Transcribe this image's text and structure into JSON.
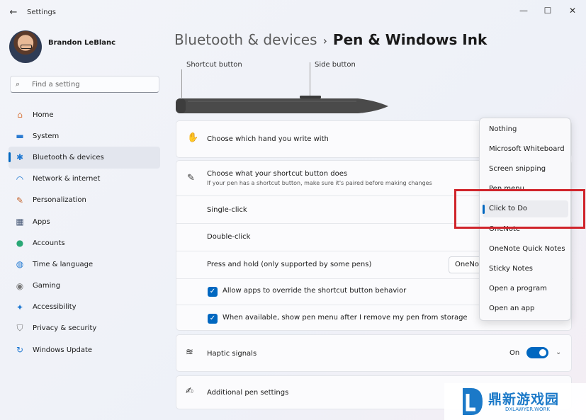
{
  "window": {
    "title": "Settings",
    "back_glyph": "←",
    "min_glyph": "—",
    "max_glyph": "☐",
    "close_glyph": "✕"
  },
  "user": {
    "name": "Brandon LeBlanc"
  },
  "search": {
    "placeholder": "Find a setting",
    "icon": "search-icon"
  },
  "nav": {
    "items": [
      {
        "label": "Home",
        "icon": "home-icon",
        "glyph": "⌂",
        "color": "#d8743a"
      },
      {
        "label": "System",
        "icon": "system-icon",
        "glyph": "▬",
        "color": "#2c7bd1"
      },
      {
        "label": "Bluetooth & devices",
        "icon": "bluetooth-icon",
        "glyph": "✱",
        "color": "#1f78d1",
        "active": true
      },
      {
        "label": "Network & internet",
        "icon": "wifi-icon",
        "glyph": "◠",
        "color": "#1f78d1"
      },
      {
        "label": "Personalization",
        "icon": "brush-icon",
        "glyph": "✎",
        "color": "#c4622a"
      },
      {
        "label": "Apps",
        "icon": "apps-icon",
        "glyph": "▦",
        "color": "#4a5b78"
      },
      {
        "label": "Accounts",
        "icon": "accounts-icon",
        "glyph": "●",
        "color": "#2aa876"
      },
      {
        "label": "Time & language",
        "icon": "globe-icon",
        "glyph": "◍",
        "color": "#1f78d1"
      },
      {
        "label": "Gaming",
        "icon": "gamepad-icon",
        "glyph": "◉",
        "color": "#777777"
      },
      {
        "label": "Accessibility",
        "icon": "accessibility-icon",
        "glyph": "✦",
        "color": "#1f78d1"
      },
      {
        "label": "Privacy & security",
        "icon": "shield-icon",
        "glyph": "⛉",
        "color": "#777777"
      },
      {
        "label": "Windows Update",
        "icon": "update-icon",
        "glyph": "↻",
        "color": "#1f78d1"
      }
    ]
  },
  "breadcrumb": {
    "parent": "Bluetooth & devices",
    "separator": "›",
    "current": "Pen & Windows Ink"
  },
  "pen_diagram": {
    "shortcut_label": "Shortcut button",
    "side_label": "Side button"
  },
  "rows": {
    "hand": {
      "label": "Choose which hand you write with",
      "icon": "hand-icon",
      "glyph": "✋"
    },
    "shortcut": {
      "label": "Choose what your shortcut button does",
      "sub": "If your pen has a shortcut button, make sure it's paired before making changes",
      "icon": "pen-icon",
      "glyph": "✎"
    },
    "single_click": {
      "label": "Single-click"
    },
    "double_click": {
      "label": "Double-click"
    },
    "press_hold": {
      "label": "Press and hold (only supported by some pens)",
      "value": "OneNo"
    },
    "allow_override": {
      "label": "Allow apps to override the shortcut button behavior",
      "checked": true
    },
    "show_pen_menu": {
      "label": "When available, show pen menu after I remove my pen from storage",
      "checked": true
    },
    "haptic": {
      "label": "Haptic signals",
      "icon": "haptic-icon",
      "glyph": "≋",
      "toggle_label": "On",
      "toggle_on": true
    },
    "additional": {
      "label": "Additional pen settings",
      "icon": "pen-settings-icon",
      "glyph": "✍"
    }
  },
  "dropdown": {
    "items": [
      "Nothing",
      "Microsoft Whiteboard",
      "Screen snipping",
      "Pen menu",
      "Click to Do",
      "OneNote",
      "OneNote Quick Notes",
      "Sticky Notes",
      "Open a program",
      "Open an app"
    ],
    "selected": "Click to Do",
    "accent": "#0067c0",
    "highlight_color": "#d0242b"
  },
  "watermark": {
    "title": "鼎新游戏园",
    "url": "DXLAWYER.WORK"
  }
}
